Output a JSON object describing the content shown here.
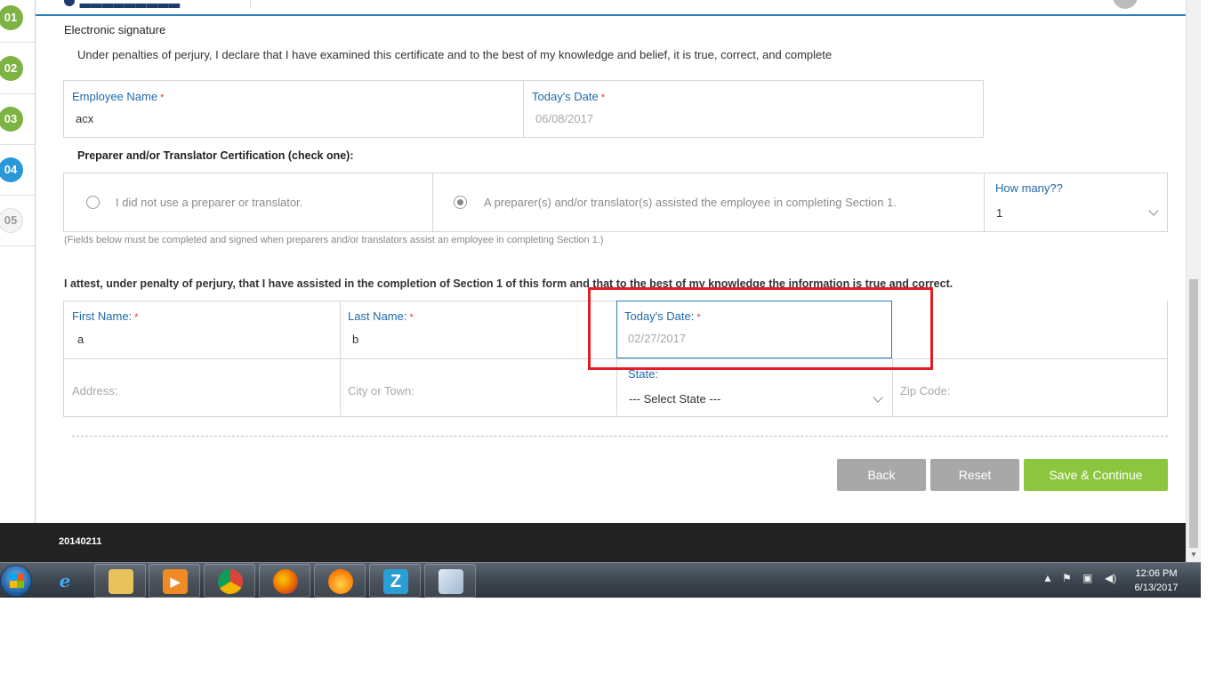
{
  "steps": [
    "01",
    "02",
    "03",
    "04",
    "05"
  ],
  "signature": {
    "title": "Electronic signature",
    "declaration": "Under penalties of perjury, I declare that I have examined this certificate and to the best of my knowledge and belief, it is true, correct, and complete",
    "employee_name_label": "Employee Name",
    "employee_name_value": "acx",
    "todays_date_label": "Today's Date",
    "todays_date_value": "06/08/2017"
  },
  "preparer": {
    "title": "Preparer and/or Translator Certification (check one):",
    "option_no": "I did not use a preparer or translator.",
    "option_yes": "A preparer(s) and/or translator(s) assisted the employee in completing Section 1.",
    "how_many_label": "How many??",
    "how_many_value": "1",
    "note": "(Fields below must be completed and signed when preparers and/or translators assist an employee in completing Section 1.)",
    "attest": "I attest, under penalty of perjury, that I have assisted in the completion of Section 1 of this form and that to the best of my knowledge the information is true and correct.",
    "first_name_label": "First Name:",
    "first_name_value": "a",
    "last_name_label": "Last Name:",
    "last_name_value": "b",
    "date_label": "Today's Date:",
    "date_placeholder": "02/27/2017",
    "address_placeholder": "Address:",
    "city_placeholder": "City or Town:",
    "state_label": "State:",
    "state_value": "--- Select State ---",
    "zip_placeholder": "Zip Code:",
    "required_mark": "*"
  },
  "buttons": {
    "back": "Back",
    "reset": "Reset",
    "save": "Save & Continue"
  },
  "footer": {
    "text": "20140211"
  },
  "taskbar": {
    "time": "12:06 PM",
    "date": "6/13/2017",
    "apps": [
      "internet-explorer-icon",
      "file-explorer-icon",
      "media-player-icon",
      "chrome-icon",
      "firefox-icon",
      "flame-app-icon",
      "z-app-icon",
      "notepad-app-icon"
    ]
  },
  "colors": {
    "accent_blue": "#2069a8",
    "step_done": "#7cb342",
    "step_active": "#2a98d8",
    "save_green": "#8cc63f",
    "highlight_red": "#e01e25"
  }
}
